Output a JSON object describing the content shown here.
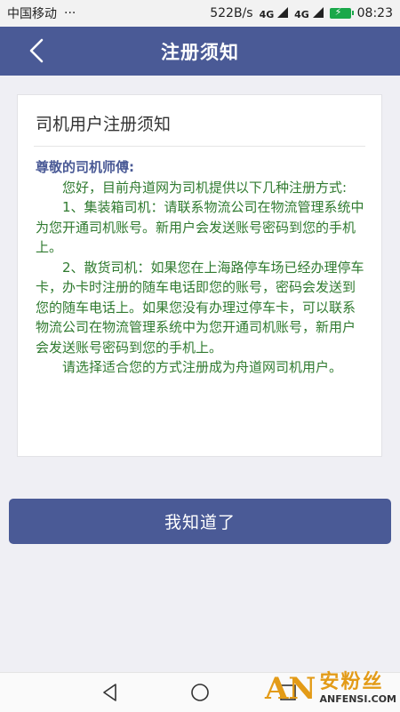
{
  "status_bar": {
    "carrier": "中国移动",
    "more": "···",
    "net_speed": "522B/s",
    "net_type_1": "4G",
    "net_type_2": "4G",
    "time": "08:23"
  },
  "nav": {
    "title": "注册须知",
    "back_icon": "chevron-left-icon"
  },
  "card": {
    "title": "司机用户注册须知",
    "greeting": "尊敬的司机师傅:",
    "paragraphs": [
      "您好，目前舟道网为司机提供以下几种注册方式:",
      "1、集装箱司机：请联系物流公司在物流管理系统中为您开通司机账号。新用户会发送账号密码到您的手机上。",
      "2、散货司机：如果您在上海路停车场已经办理停车卡，办卡时注册的随车电话即您的账号，密码会发送到您的随车电话上。如果您没有办理过停车卡，可以联系 物流公司在物流管理系统中为您开通司机账号，新用户会发送账号密码到您的手机上。",
      "请选择适合您的方式注册成为舟道网司机用户。"
    ]
  },
  "confirm_button": "我知道了",
  "watermark": {
    "logo": "AN",
    "cn": "安粉丝",
    "en": "ANFENSI.COM"
  },
  "colors": {
    "nav": "#4a5a96",
    "greeting": "#4a5a96",
    "body_text": "#2f7a2f",
    "button": "#4a5a96",
    "background": "#efeff4"
  }
}
